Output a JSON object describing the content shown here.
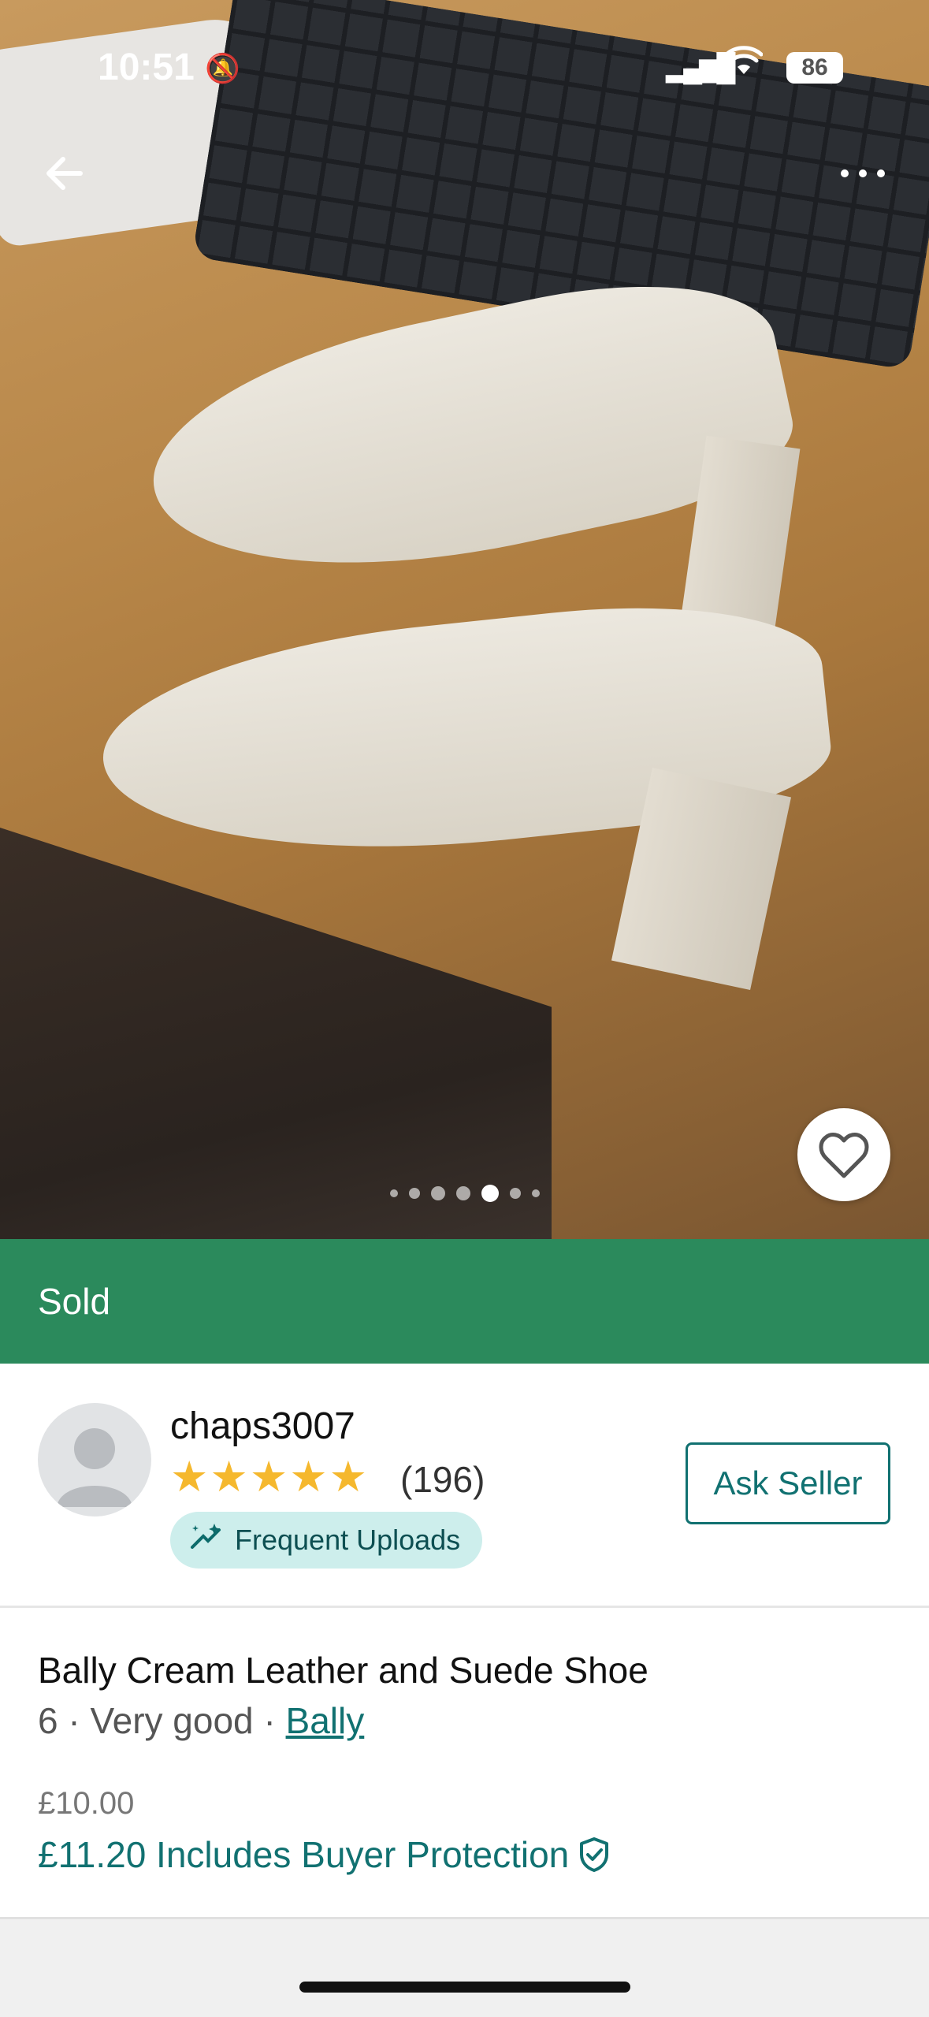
{
  "status_bar": {
    "time": "10:51",
    "battery": "86",
    "icons": [
      "bell-slash-icon",
      "signal-icon",
      "wifi-icon",
      "battery-icon"
    ]
  },
  "nav": {
    "back_icon": "arrow-left-icon",
    "more_icon": "more-horizontal-icon"
  },
  "gallery": {
    "image_count": 7,
    "active_index": 4,
    "favorite_icon": "heart-icon"
  },
  "status_banner": {
    "label": "Sold",
    "color": "#2b8a5c"
  },
  "seller": {
    "username": "chaps3007",
    "rating_stars": 5,
    "stars_text": "★★★★★",
    "review_count": "(196)",
    "badge_label": "Frequent Uploads",
    "badge_icon": "sparkle-upload-icon",
    "ask_button_label": "Ask Seller"
  },
  "item": {
    "title": "Bally Cream Leather and Suede Shoe",
    "size": "6",
    "separator": "·",
    "condition": "Very good",
    "brand": "Bally",
    "price": "£10.00",
    "total_price_text": "£11.20 Includes Buyer Protection",
    "protection_icon": "shield-check-icon"
  },
  "colors": {
    "accent": "#117171",
    "sold_green": "#2b8a5c",
    "star": "#f5b82e",
    "badge_bg": "#cdeeec"
  }
}
